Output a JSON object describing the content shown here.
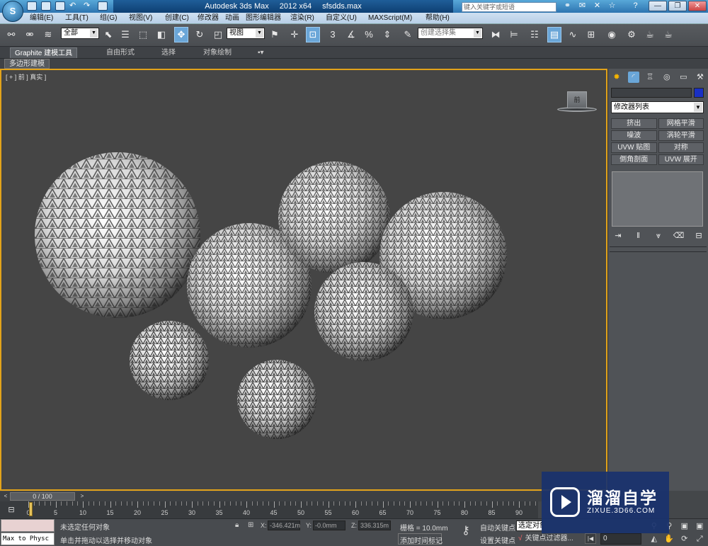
{
  "title": {
    "app": "Autodesk 3ds Max",
    "version": "2012 x64",
    "file": "sfsdds.max",
    "search_placeholder": "键入关键字或短语"
  },
  "logo_text": "S",
  "menu": [
    "编辑(E)",
    "工具(T)",
    "组(G)",
    "视图(V)",
    "创建(C)",
    "修改器",
    "动画",
    "图形编辑器",
    "渲染(R)",
    "自定义(U)",
    "MAXScript(M)",
    "帮助(H)"
  ],
  "toolbar": {
    "selection_filter": "全部",
    "ref_coord": "视图",
    "named_selection": "创建选择集",
    "angle_snap_label": "3",
    "percent_label": "%"
  },
  "ribbon": {
    "tabs": [
      "Graphite 建模工具",
      "自由形式",
      "选择",
      "对象绘制"
    ],
    "active": "Graphite 建模工具",
    "sub": "多边形建模"
  },
  "viewport": {
    "label": "[ + ] 前 ] 真实 ]",
    "viewcube_label": "前",
    "active_border_color": "#e2a31a"
  },
  "command_panel": {
    "modifier_list": "修改器列表",
    "object_color": "#1930c4",
    "modifier_buttons": [
      "挤出",
      "网格平滑",
      "噪波",
      "涡轮平滑",
      "UVW 贴图",
      "对称",
      "倒角剖面",
      "UVW 展开"
    ]
  },
  "time": {
    "slider_label": "0 / 100",
    "ticks": [
      "0",
      "5",
      "10",
      "15",
      "20",
      "25",
      "30",
      "35",
      "40",
      "45",
      "50",
      "55",
      "60",
      "65",
      "70",
      "75",
      "80",
      "85",
      "90"
    ]
  },
  "status": {
    "maxscript_text": "Max to Physc (",
    "line1": "未选定任何对象",
    "line2": "单击并拖动以选择并移动对象",
    "x_label": "X:",
    "x": "-346.421m",
    "y_label": "Y:",
    "y": "-0.0mm",
    "z_label": "Z:",
    "z": "336.315m",
    "grid": "栅格 = 10.0mm",
    "add_time_tag": "添加时间标记",
    "auto_key": "自动关键点",
    "set_key": "设置关键点",
    "selected_set": "选定对象",
    "key_filter": "关键点过滤器...",
    "frame": "0"
  },
  "watermark": {
    "cn": "溜溜自学",
    "url": "ZIXUE.3D66.COM"
  }
}
